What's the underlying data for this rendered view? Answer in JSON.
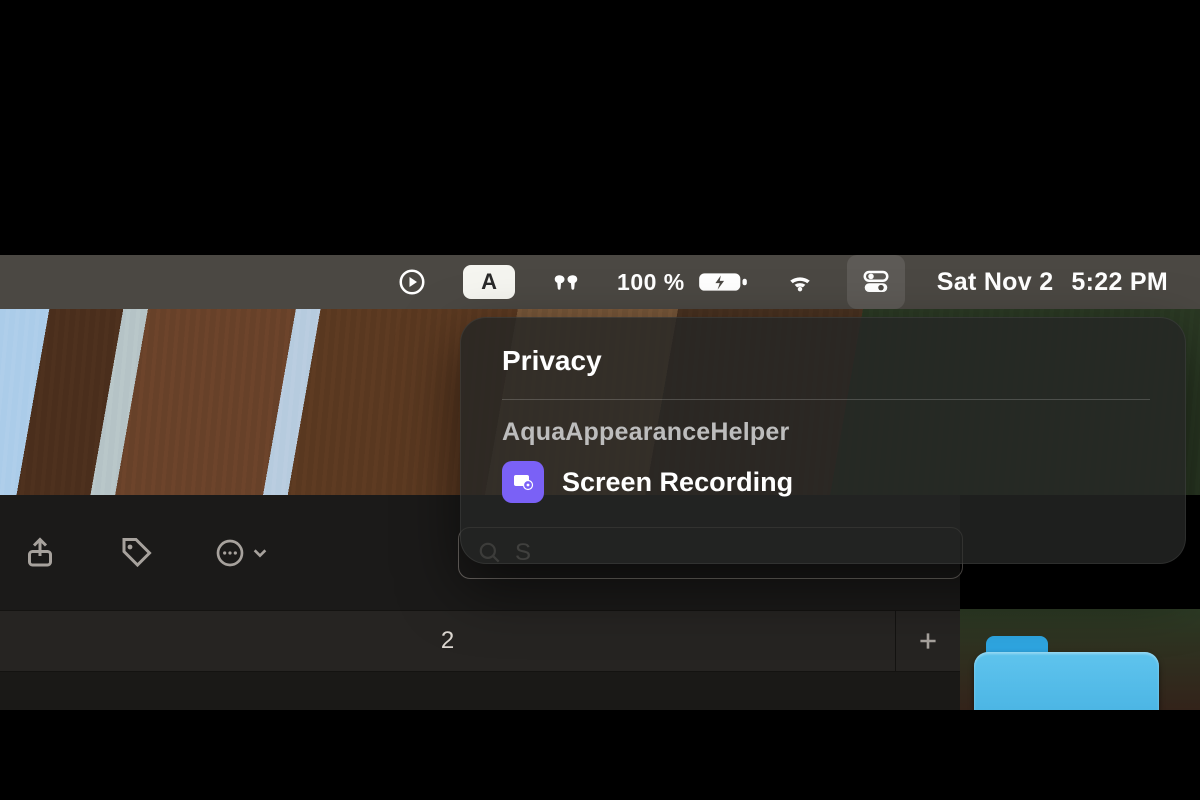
{
  "menubar": {
    "input_source_label": "A",
    "battery_percent": "100 %",
    "date": "Sat Nov 2",
    "time": "5:22 PM"
  },
  "toolbar": {
    "search_prefix": "S"
  },
  "tabs": {
    "active_label": "2"
  },
  "privacy_panel": {
    "title": "Privacy",
    "app_name": "AquaAppearanceHelper",
    "permission_label": "Screen Recording"
  }
}
